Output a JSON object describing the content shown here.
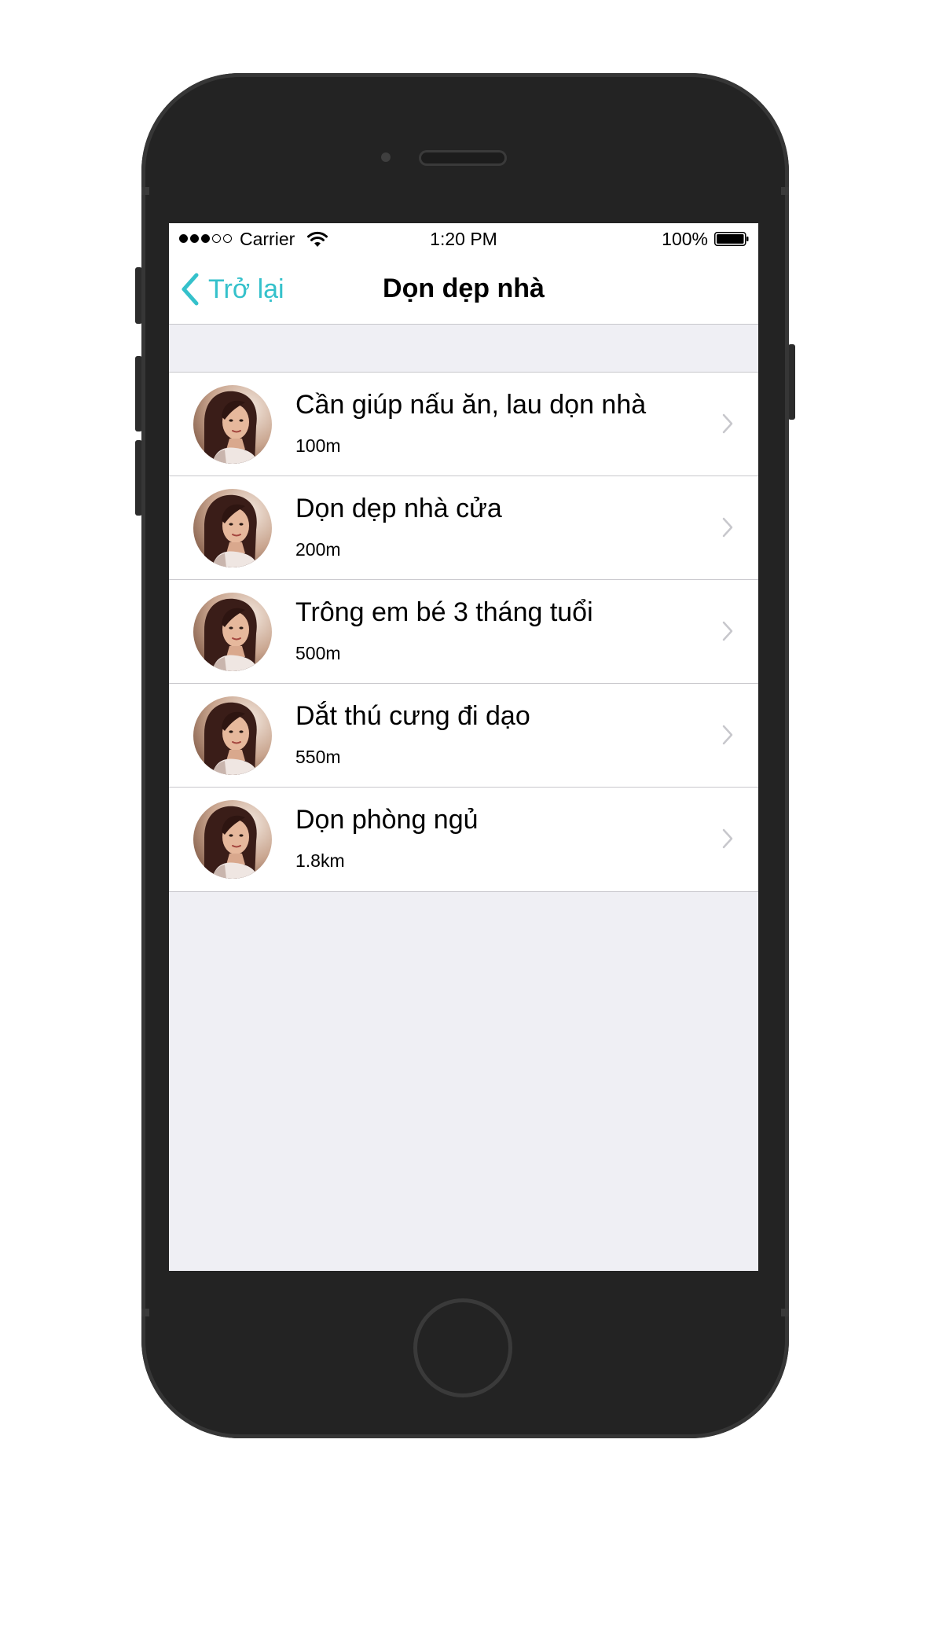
{
  "status_bar": {
    "signal_dots_filled": 3,
    "signal_dots_total": 5,
    "carrier": "Carrier",
    "time": "1:20 PM",
    "battery_percent": "100%",
    "battery_level": 1.0
  },
  "nav": {
    "back_label": "Trở lại",
    "title": "Dọn dẹp nhà"
  },
  "colors": {
    "accent": "#35c1cb",
    "background": "#efeff4",
    "separator": "#c8c7cc",
    "chevron": "#c7c7cc"
  },
  "items": [
    {
      "title": "Cần giúp nấu ăn, lau dọn nhà",
      "distance": "100m",
      "icon": "avatar-photo"
    },
    {
      "title": "Dọn dẹp nhà cửa",
      "distance": "200m",
      "icon": "avatar-photo"
    },
    {
      "title": "Trông em bé 3 tháng tuổi",
      "distance": "500m",
      "icon": "avatar-photo"
    },
    {
      "title": "Dắt thú cưng đi dạo",
      "distance": "550m",
      "icon": "avatar-photo"
    },
    {
      "title": "Dọn phòng ngủ",
      "distance": "1.8km",
      "icon": "avatar-photo"
    }
  ]
}
